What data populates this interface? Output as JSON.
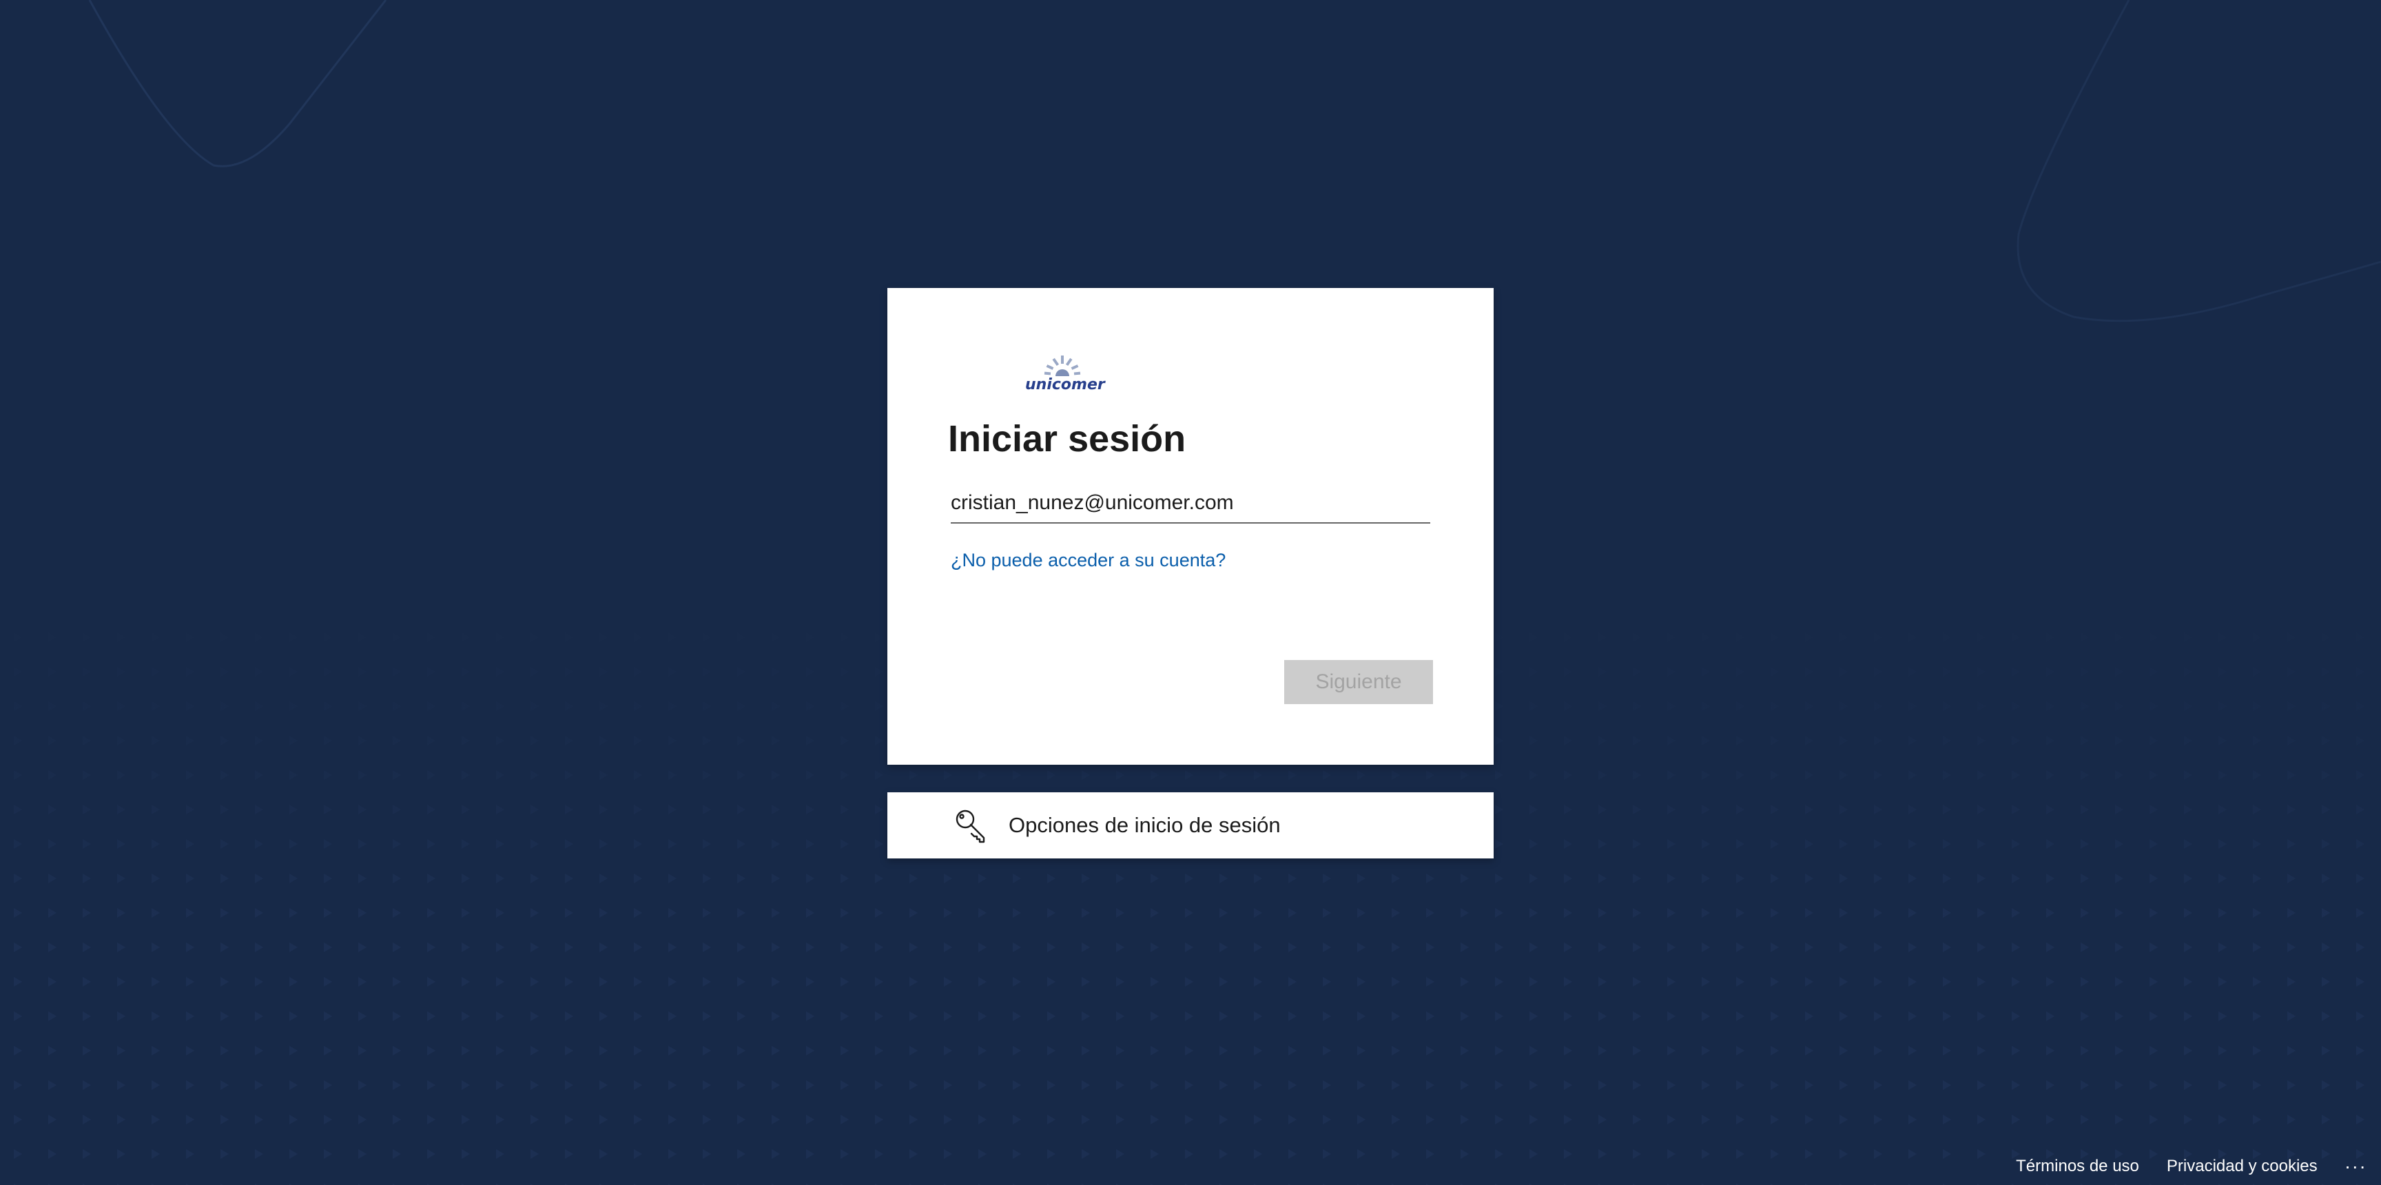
{
  "brand": {
    "logo_text": "unicomer",
    "logo_color": "#273f8c"
  },
  "signin": {
    "title": "Iniciar sesión",
    "email_value": "cristian_nunez@unicomer.com",
    "help_link": "¿No puede acceder a su cuenta?",
    "next_label": "Siguiente"
  },
  "options": {
    "icon": "key-icon",
    "label": "Opciones de inicio de sesión"
  },
  "footer": {
    "terms": "Términos de uso",
    "privacy": "Privacidad y cookies",
    "more": "..."
  },
  "colors": {
    "background": "#172948",
    "link": "#0a5eab",
    "button_disabled": "#cccccc"
  }
}
